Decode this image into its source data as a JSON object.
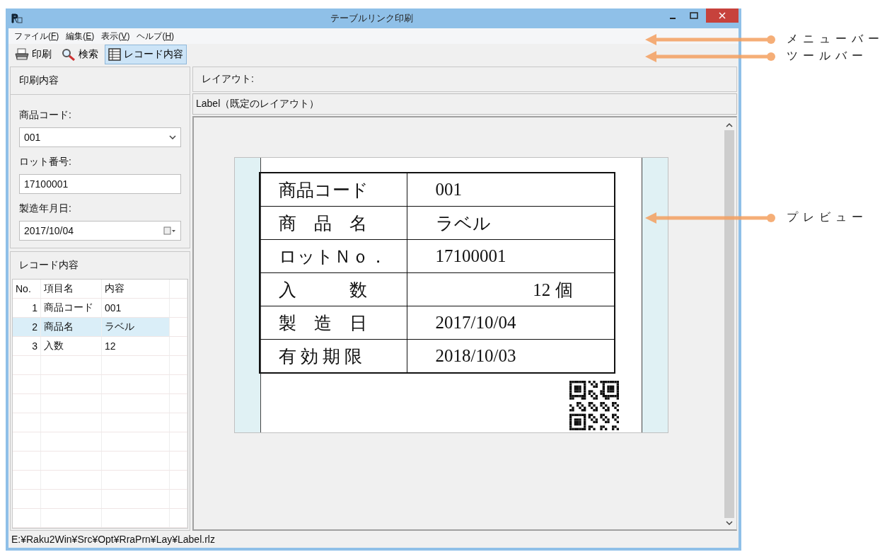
{
  "window": {
    "title": "テーブルリンク印刷"
  },
  "menu": [
    {
      "before": "ファイル(",
      "mnemonic": "F",
      "after": ")"
    },
    {
      "before": "編集(",
      "mnemonic": "E",
      "after": ")"
    },
    {
      "before": "表示(",
      "mnemonic": "V",
      "after": ")"
    },
    {
      "before": "ヘルプ(",
      "mnemonic": "H",
      "after": ")"
    }
  ],
  "toolbar": [
    {
      "kind": "printer",
      "label": "印刷",
      "selected": false
    },
    {
      "kind": "search",
      "label": "検索",
      "selected": false
    },
    {
      "kind": "table",
      "label": "レコード内容",
      "selected": true
    }
  ],
  "print_panel": {
    "title": "印刷内容",
    "fields": [
      {
        "kind": "select",
        "label": "商品コード:",
        "value": "001"
      },
      {
        "kind": "text",
        "label": "ロット番号:",
        "value": "17100001"
      },
      {
        "kind": "date",
        "label": "製造年月日:",
        "value": "2017/10/04"
      }
    ]
  },
  "record_panel": {
    "title": "レコード内容",
    "columns": [
      "No.",
      "項目名",
      "内容"
    ],
    "rows": [
      {
        "no": "1",
        "name": "商品コード",
        "value": "001",
        "selected": false
      },
      {
        "no": "2",
        "name": "商品名",
        "value": "ラベル",
        "selected": true
      },
      {
        "no": "3",
        "name": "入数",
        "value": "12",
        "selected": false
      }
    ]
  },
  "layout_panel": {
    "title": "レイアウト:",
    "layout": "Label（既定のレイアウト）"
  },
  "preview": {
    "rows": [
      {
        "label": "商品コード",
        "value": "001",
        "kind": "text"
      },
      {
        "label": "商　品　名",
        "value": "ラベル",
        "kind": "text"
      },
      {
        "label": "ロットＮｏ．",
        "value": "17100001",
        "kind": "text"
      },
      {
        "label": "入　　　数",
        "value": "12 個",
        "kind": "quantity"
      },
      {
        "label": "製　造　日",
        "value": "2017/10/04",
        "kind": "text"
      },
      {
        "label": "有 効 期 限",
        "value": "2018/10/03",
        "kind": "text"
      }
    ]
  },
  "status_bar": "E:¥Raku2Win¥Src¥Opt¥RraPrn¥Lay¥Label.rlz",
  "annotations": [
    {
      "label": "メニューバー"
    },
    {
      "label": "ツールバー"
    },
    {
      "label": "プレビュー"
    }
  ]
}
